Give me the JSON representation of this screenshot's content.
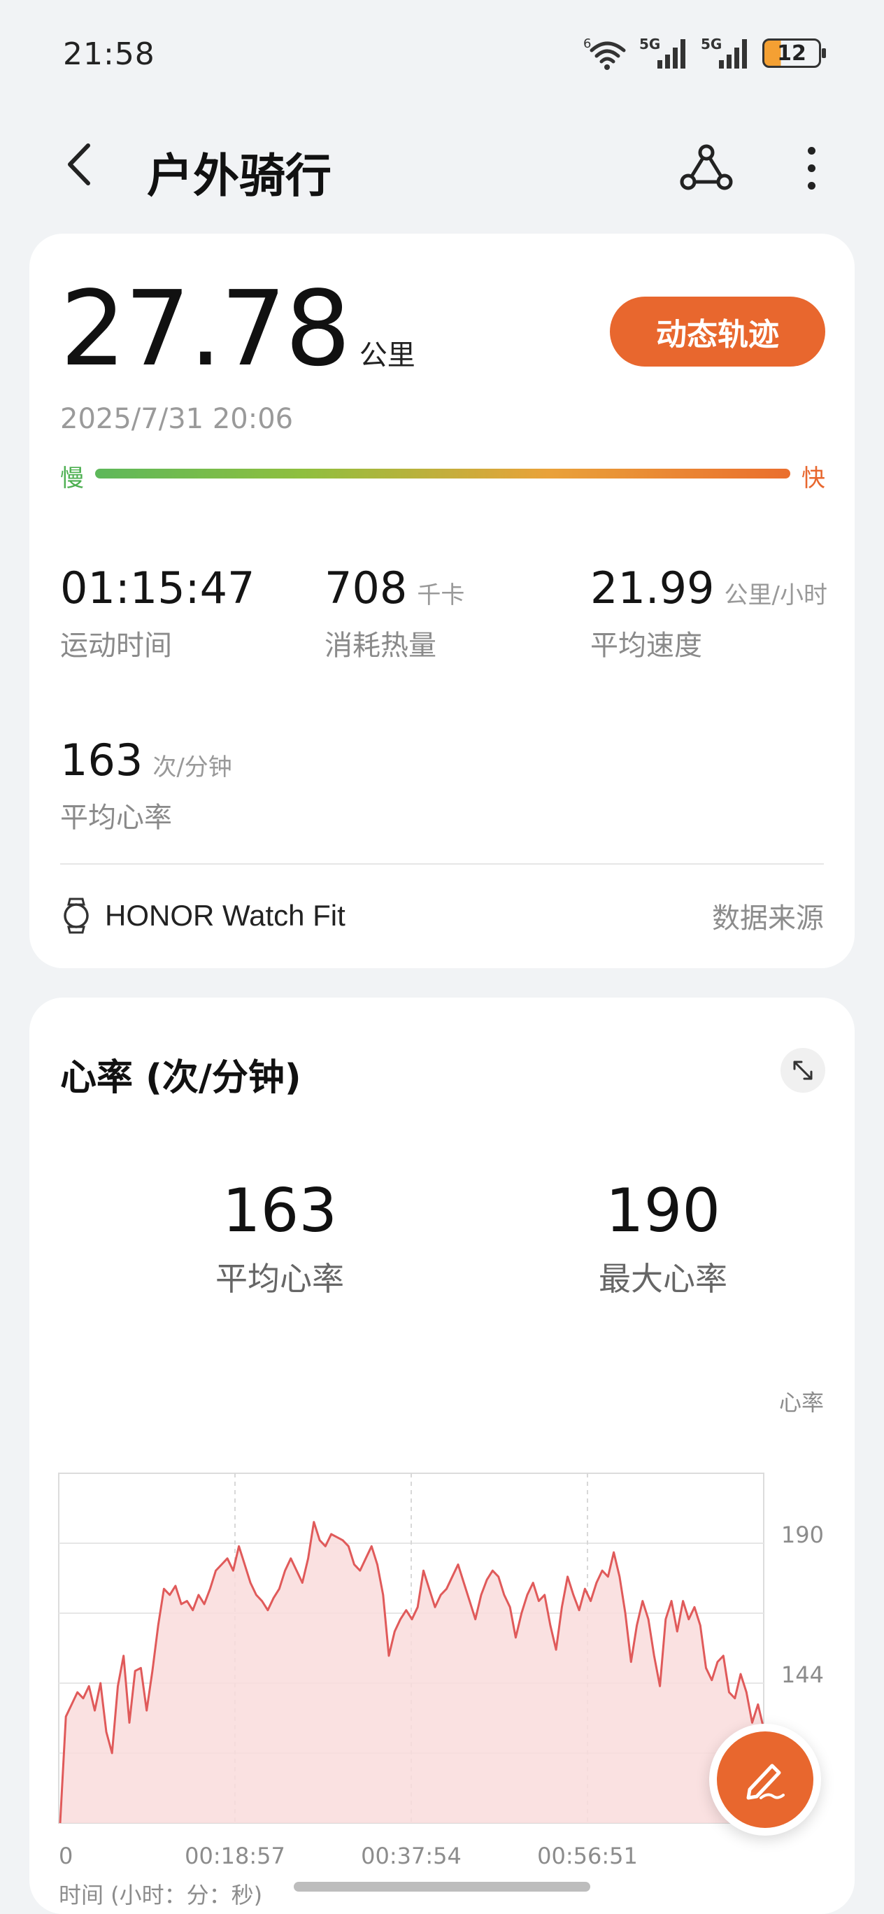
{
  "status_bar": {
    "time": "21:58",
    "wifi_label": "6",
    "signal1_label": "5G",
    "signal2_label": "5G",
    "battery": "12"
  },
  "header": {
    "title": "户外骑行"
  },
  "summary": {
    "distance_value": "27.78",
    "distance_unit": "公里",
    "track_button": "动态轨迹",
    "date": "2025/7/31 20:06",
    "speed_slow": "慢",
    "speed_fast": "快",
    "metrics": [
      {
        "value": "01:15:47",
        "unit": "",
        "label": "运动时间"
      },
      {
        "value": "708",
        "unit": "千卡",
        "label": "消耗热量"
      },
      {
        "value": "21.99",
        "unit": "公里/小时",
        "label": "平均速度"
      },
      {
        "value": "163",
        "unit": "次/分钟",
        "label": "平均心率"
      }
    ],
    "device": "HONOR Watch Fit",
    "source_link": "数据来源"
  },
  "heart_rate": {
    "title": "心率 (次/分钟)",
    "avg_value": "163",
    "avg_label": "平均心率",
    "max_value": "190",
    "max_label": "最大心率"
  },
  "chart_data": {
    "type": "area",
    "ylabel": "心率",
    "xlabel": "时间 (小时：分：秒)",
    "x_ticks": [
      "0",
      "00:18:57",
      "00:37:54",
      "00:56:51"
    ],
    "y_ticks": [
      190,
      144
    ],
    "ylim": [
      95,
      210
    ],
    "color": "#e05a5a",
    "fill": "#f9dcdc",
    "series": [
      {
        "values": [
          95,
          130,
          134,
          138,
          136,
          140,
          132,
          141,
          125,
          118,
          140,
          150,
          128,
          145,
          146,
          132,
          145,
          160,
          172,
          170,
          173,
          167,
          168,
          165,
          170,
          167,
          172,
          178,
          180,
          182,
          178,
          186,
          180,
          174,
          170,
          168,
          165,
          169,
          172,
          178,
          182,
          178,
          174,
          182,
          194,
          188,
          186,
          190,
          189,
          188,
          186,
          180,
          178,
          182,
          186,
          180,
          170,
          150,
          158,
          162,
          165,
          162,
          166,
          178,
          172,
          166,
          170,
          172,
          176,
          180,
          174,
          168,
          162,
          170,
          175,
          178,
          176,
          170,
          166,
          156,
          164,
          170,
          174,
          168,
          170,
          160,
          152,
          166,
          176,
          170,
          165,
          172,
          168,
          174,
          178,
          176,
          184,
          176,
          164,
          148,
          160,
          168,
          162,
          150,
          140,
          162,
          168,
          158,
          168,
          162,
          166,
          160,
          146,
          142,
          148,
          150,
          138,
          136,
          144,
          138,
          128,
          134,
          126
        ]
      }
    ]
  },
  "icons": {
    "back": "back-arrow-icon",
    "route": "route-share-icon",
    "more": "more-vertical-icon",
    "watch": "watch-icon",
    "expand": "expand-icon",
    "edit": "edit-pen-icon"
  },
  "colors": {
    "accent": "#e8672e",
    "chart_line": "#e05a5a",
    "speed_slow": "#4caf50",
    "speed_fast": "#e8672e"
  }
}
